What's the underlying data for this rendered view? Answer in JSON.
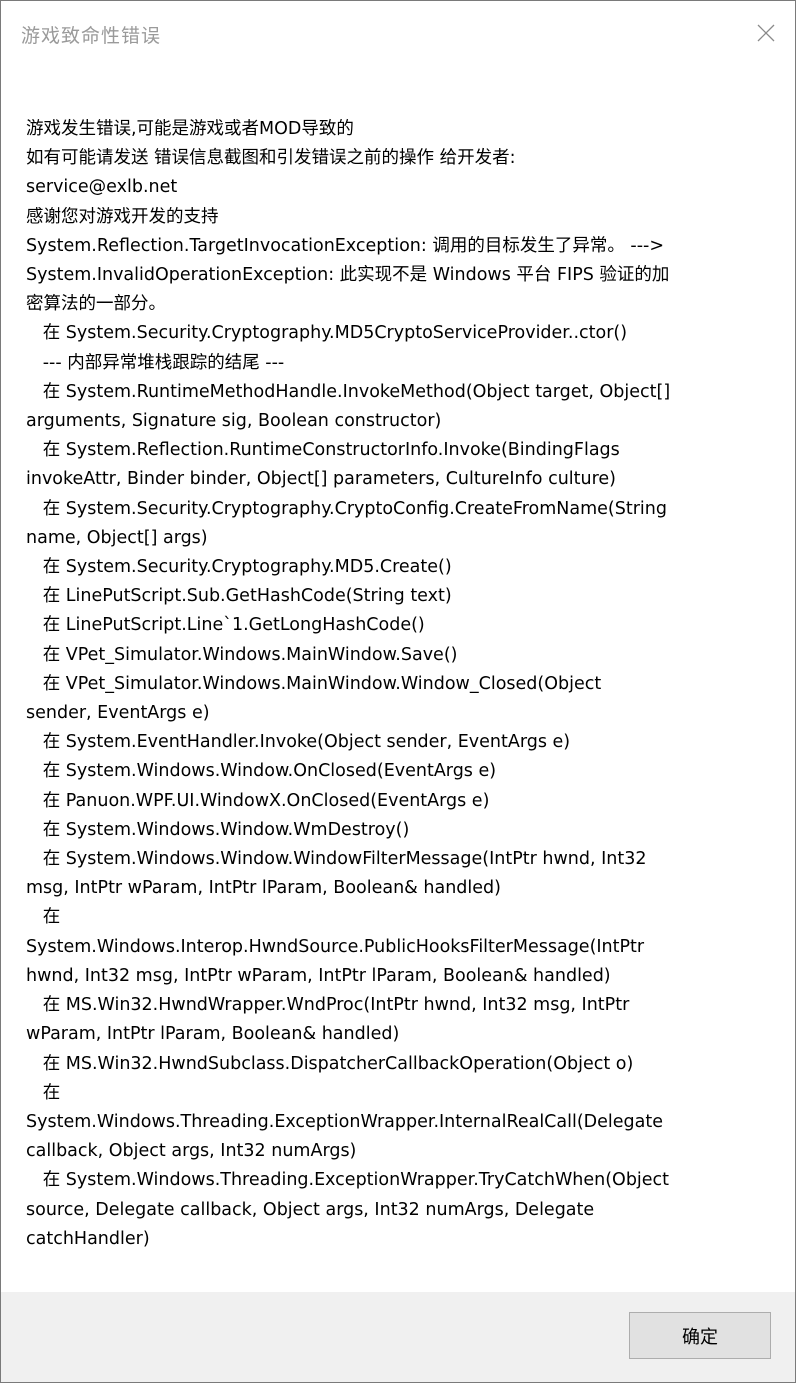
{
  "window": {
    "title": "游戏致命性错误",
    "close_icon": "close-icon"
  },
  "message": {
    "text": "游戏发生错误,可能是游戏或者MOD导致的\n如有可能请发送 错误信息截图和引发错误之前的操作 给开发者:\nservice@exlb.net\n感谢您对游戏开发的支持\nSystem.Reflection.TargetInvocationException: 调用的目标发生了异常。 --->\nSystem.InvalidOperationException: 此实现不是 Windows 平台 FIPS 验证的加\n密算法的一部分。\n   在 System.Security.Cryptography.MD5CryptoServiceProvider..ctor()\n   --- 内部异常堆栈跟踪的结尾 ---\n   在 System.RuntimeMethodHandle.InvokeMethod(Object target, Object[]\narguments, Signature sig, Boolean constructor)\n   在 System.Reflection.RuntimeConstructorInfo.Invoke(BindingFlags\ninvokeAttr, Binder binder, Object[] parameters, CultureInfo culture)\n   在 System.Security.Cryptography.CryptoConfig.CreateFromName(String\nname, Object[] args)\n   在 System.Security.Cryptography.MD5.Create()\n   在 LinePutScript.Sub.GetHashCode(String text)\n   在 LinePutScript.Line`1.GetLongHashCode()\n   在 VPet_Simulator.Windows.MainWindow.Save()\n   在 VPet_Simulator.Windows.MainWindow.Window_Closed(Object\nsender, EventArgs e)\n   在 System.EventHandler.Invoke(Object sender, EventArgs e)\n   在 System.Windows.Window.OnClosed(EventArgs e)\n   在 Panuon.WPF.UI.WindowX.OnClosed(EventArgs e)\n   在 System.Windows.Window.WmDestroy()\n   在 System.Windows.Window.WindowFilterMessage(IntPtr hwnd, Int32\nmsg, IntPtr wParam, IntPtr lParam, Boolean& handled)\n   在\nSystem.Windows.Interop.HwndSource.PublicHooksFilterMessage(IntPtr\nhwnd, Int32 msg, IntPtr wParam, IntPtr lParam, Boolean& handled)\n   在 MS.Win32.HwndWrapper.WndProc(IntPtr hwnd, Int32 msg, IntPtr\nwParam, IntPtr lParam, Boolean& handled)\n   在 MS.Win32.HwndSubclass.DispatcherCallbackOperation(Object o)\n   在\nSystem.Windows.Threading.ExceptionWrapper.InternalRealCall(Delegate\ncallback, Object args, Int32 numArgs)\n   在 System.Windows.Threading.ExceptionWrapper.TryCatchWhen(Object\nsource, Delegate callback, Object args, Int32 numArgs, Delegate\ncatchHandler)"
  },
  "footer": {
    "ok_label": "确定"
  },
  "colors": {
    "title_text": "#9a9a9a",
    "footer_bg": "#f0f0f0",
    "button_bg": "#e1e1e1",
    "button_border": "#adadad"
  }
}
